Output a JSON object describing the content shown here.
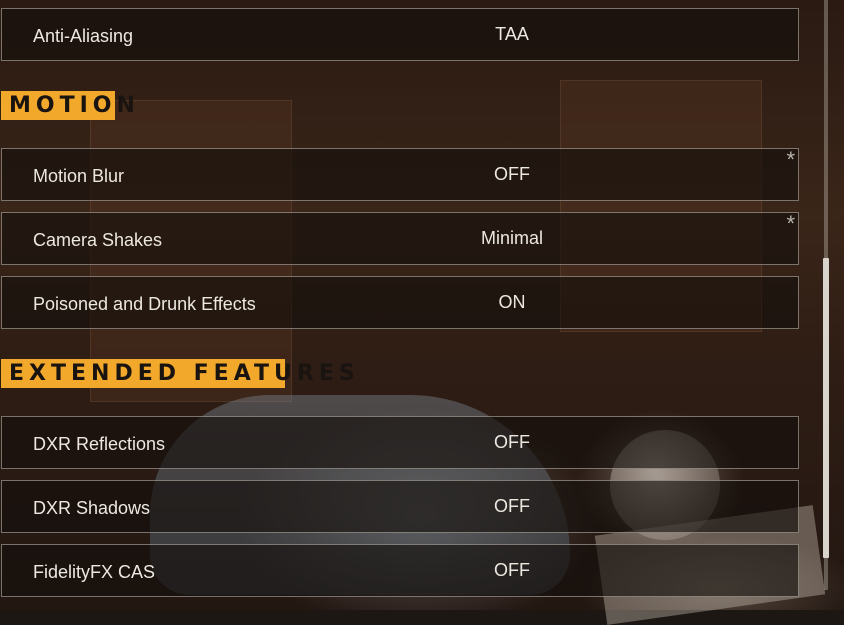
{
  "settings": {
    "anti_aliasing": {
      "label": "Anti-Aliasing",
      "value": "TAA"
    },
    "motion_header": "MOTION",
    "motion_blur": {
      "label": "Motion Blur",
      "value": "OFF",
      "marker": "*"
    },
    "camera_shakes": {
      "label": "Camera Shakes",
      "value": "Minimal",
      "marker": "*"
    },
    "poisoned_drunk": {
      "label": "Poisoned and Drunk Effects",
      "value": "ON"
    },
    "extended_header": "EXTENDED FEATURES",
    "dxr_reflections": {
      "label": "DXR Reflections",
      "value": "OFF"
    },
    "dxr_shadows": {
      "label": "DXR Shadows",
      "value": "OFF"
    },
    "fidelityfx_cas": {
      "label": "FidelityFX CAS",
      "value": "OFF"
    }
  },
  "colors": {
    "accent": "#f2a82a",
    "row_border": "#c8c3b9",
    "text": "#ece8e0"
  }
}
